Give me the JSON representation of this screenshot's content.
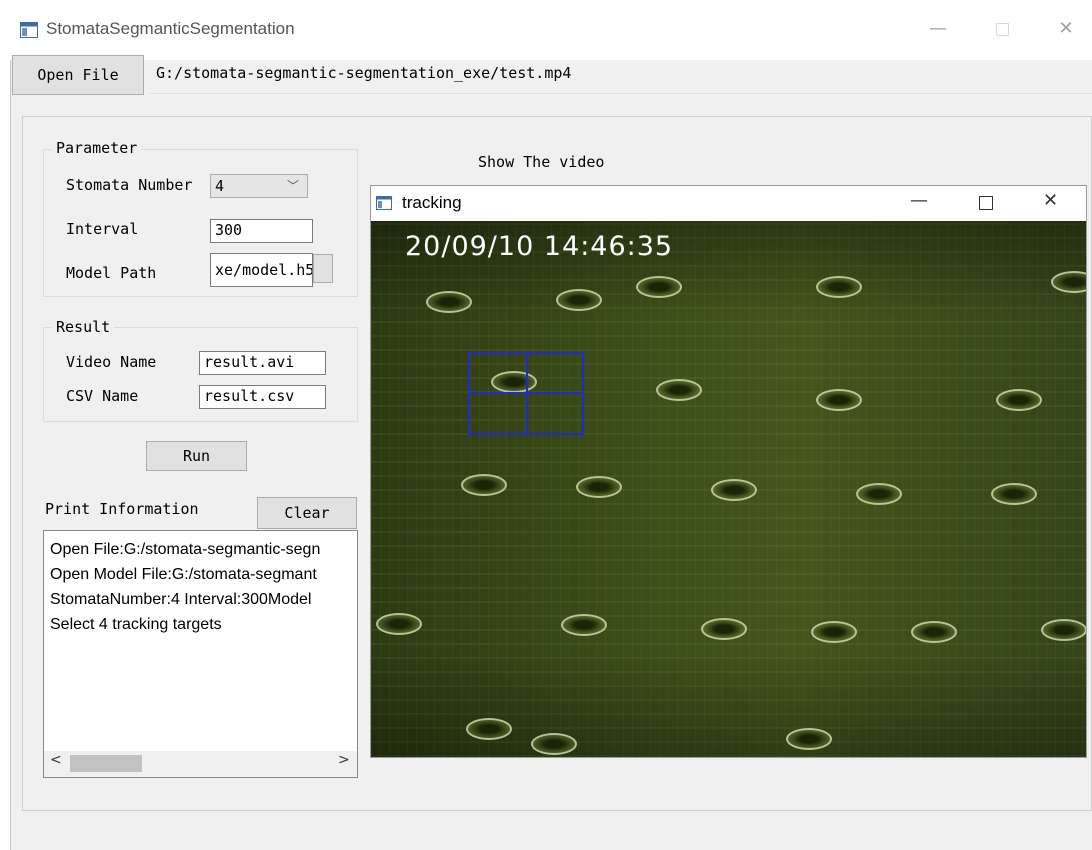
{
  "window": {
    "title": "StomataSegmanticSegmentation"
  },
  "toolbar": {
    "open_file_label": "Open File",
    "file_path": "G:/stomata-segmantic-segmentation_exe/test.mp4"
  },
  "parameter": {
    "group_title": "Parameter",
    "stomata_number_label": "Stomata Number",
    "stomata_number_value": "4",
    "interval_label": "Interval",
    "interval_value": "300",
    "model_path_label": "Model Path",
    "model_path_value": "xe/model.h5"
  },
  "result": {
    "group_title": "Result",
    "video_name_label": "Video Name",
    "video_name_value": "result.avi",
    "csv_name_label": "CSV Name",
    "csv_name_value": "result.csv"
  },
  "actions": {
    "run_label": "Run",
    "clear_label": "Clear"
  },
  "print_info": {
    "label": "Print Information",
    "lines": [
      "Open File:G:/stomata-segmantic-segn",
      "Open Model File:G:/stomata-segmant",
      "StomataNumber:4 Interval:300Model",
      "Select 4 tracking targets"
    ]
  },
  "video": {
    "show_label": "Show The video",
    "window_title": "tracking",
    "timestamp": "20/09/10 14:46:35",
    "tracking_box_color": "#1f2bd0"
  },
  "icons": {
    "minimize": "minimize-icon",
    "maximize": "maximize-icon",
    "close": "close-icon",
    "dropdown": "chevron-down-icon",
    "scroll_left": "chevron-left-icon",
    "scroll_right": "chevron-right-icon"
  }
}
